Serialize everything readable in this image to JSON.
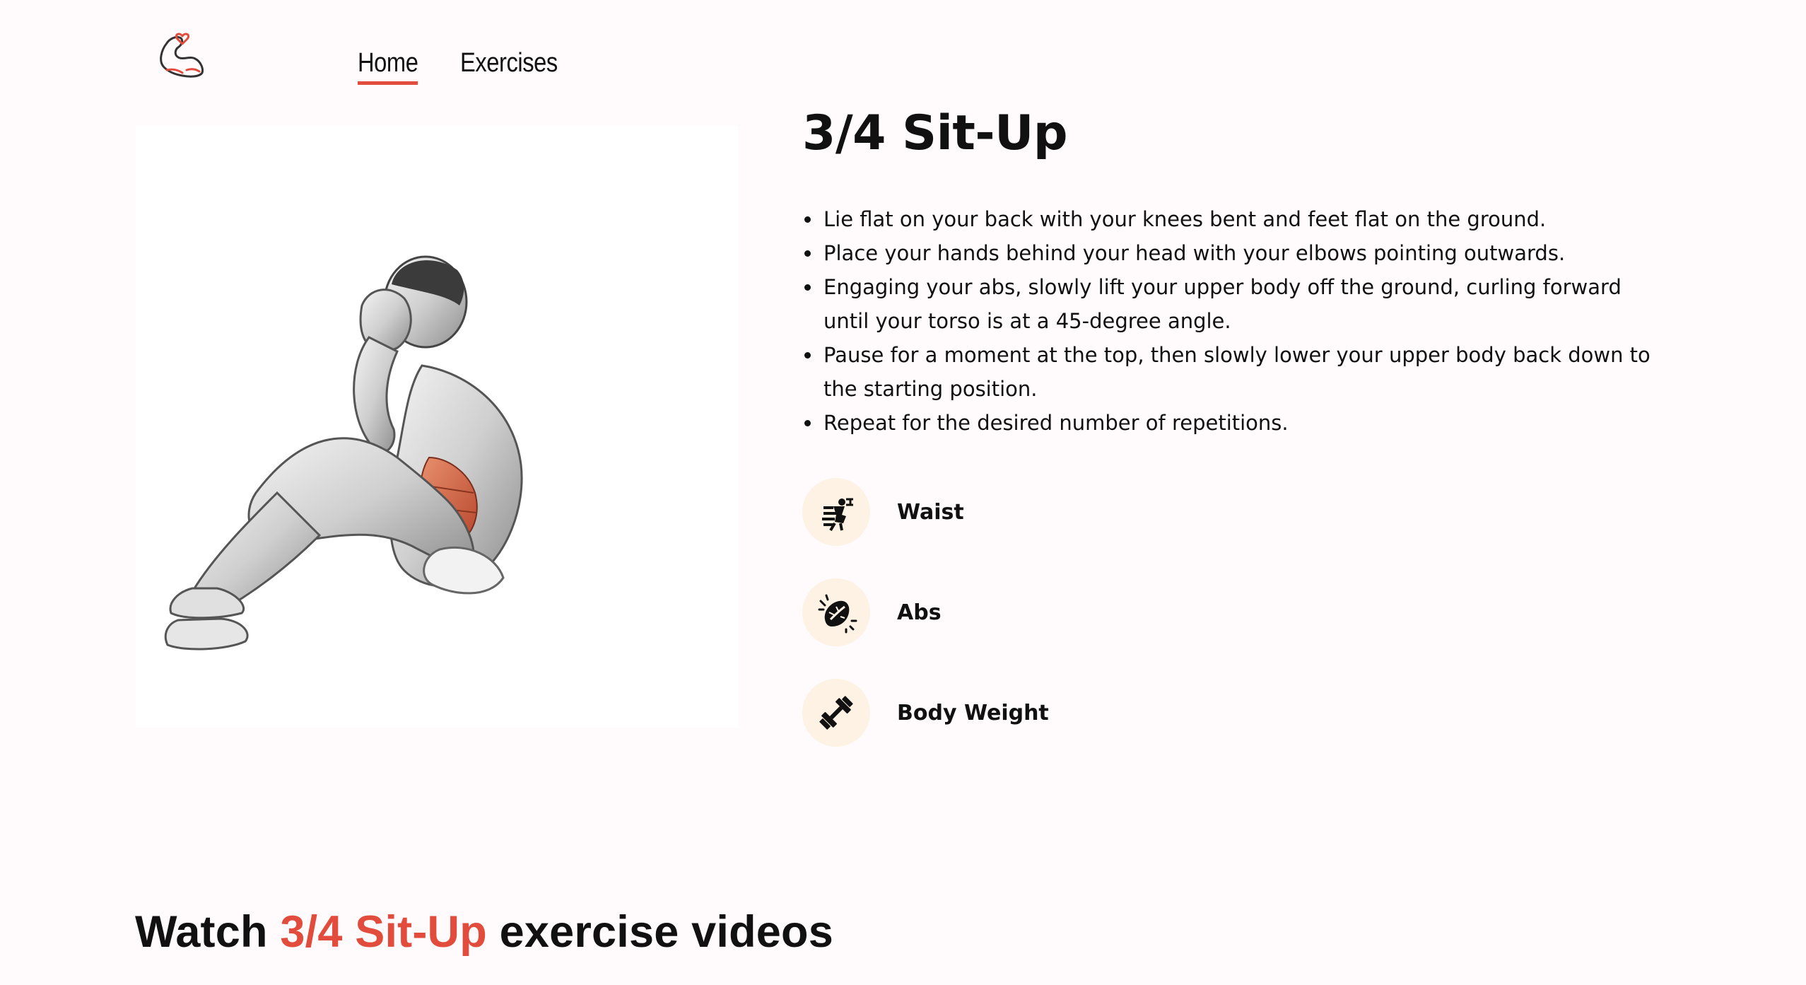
{
  "header": {
    "logo": "flexed-arm-heart-logo",
    "nav": [
      {
        "label": "Home",
        "active": true
      },
      {
        "label": "Exercises",
        "active": false
      }
    ]
  },
  "exercise": {
    "title": "3/4 Sit-Up",
    "image": "sit-up-illustration",
    "instructions": [
      "Lie flat on your back with your knees bent and feet flat on the ground.",
      "Place your hands behind your head with your elbows pointing outwards.",
      "Engaging your abs, slowly lift your upper body off the ground, curling forward until your torso is at a 45-degree angle.",
      "Pause for a moment at the top, then slowly lower your upper body back down to the starting position.",
      "Repeat for the desired number of repetitions."
    ],
    "targets": [
      {
        "label": "Waist",
        "icon": "waist-body-part-icon"
      },
      {
        "label": "Abs",
        "icon": "abs-muscle-icon"
      },
      {
        "label": "Body Weight",
        "icon": "body-weight-dumbbell-icon"
      }
    ]
  },
  "videos": {
    "prefix": "Watch ",
    "accent": "3/4 Sit-Up",
    "suffix": " exercise videos"
  },
  "colors": {
    "accent": "#e14c3c",
    "page_background": "#fffafb",
    "icon_background": "#fdf2e3"
  }
}
